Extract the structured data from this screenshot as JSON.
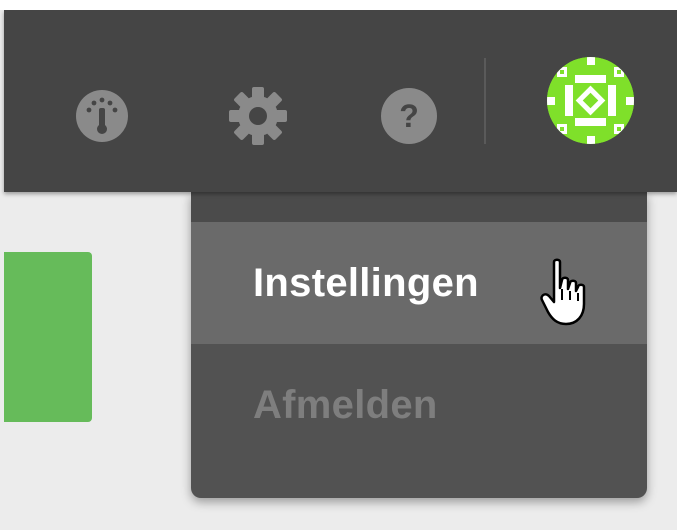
{
  "header": {
    "icons": {
      "dashboard": "gauge-icon",
      "settings": "gear-icon",
      "help": "help-icon"
    },
    "help_symbol": "?",
    "avatar_icon": "user-avatar-pattern-icon"
  },
  "user_menu": {
    "items": [
      {
        "label": "Instellingen",
        "state": "hovered"
      },
      {
        "label": "Afmelden",
        "state": "disabled"
      }
    ]
  },
  "colors": {
    "topbar": "#454545",
    "menu_bg": "#525252",
    "menu_hover": "#6a6a6a",
    "avatar": "#7fe02a",
    "card": "#66bb5a"
  }
}
